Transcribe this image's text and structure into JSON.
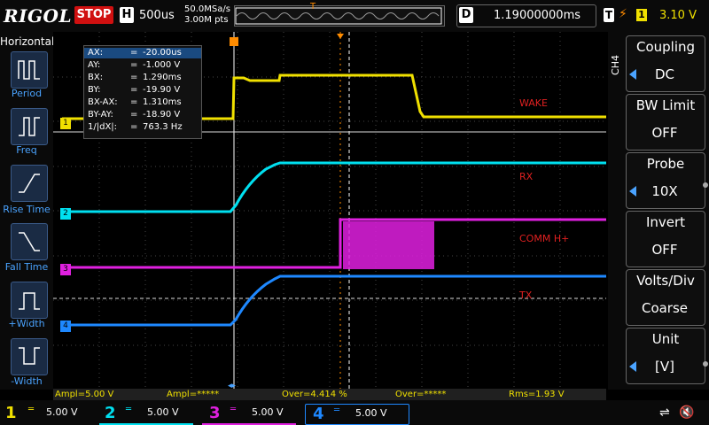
{
  "topbar": {
    "brand": "RIGOL",
    "run_state": "STOP",
    "timebase_label": "H",
    "timebase_value": "500us",
    "sample_rate": "50.0MSa/s",
    "memory_depth": "3.00M pts",
    "delay_label": "D",
    "delay_value": "1.19000000ms",
    "trigger_label": "T",
    "trigger_source": "1",
    "trigger_level": "3.10 V"
  },
  "left_panel": {
    "title": "Horizontal",
    "items": [
      {
        "label": "Period"
      },
      {
        "label": "Freq"
      },
      {
        "label": "Rise Time"
      },
      {
        "label": "Fall Time"
      },
      {
        "label": "+Width"
      },
      {
        "label": "-Width"
      }
    ]
  },
  "cursor_table": [
    {
      "key": "AX:",
      "value": "-20.00us"
    },
    {
      "key": "AY:",
      "value": "-1.000 V"
    },
    {
      "key": "BX:",
      "value": "1.290ms"
    },
    {
      "key": "BY:",
      "value": "-19.90 V"
    },
    {
      "key": "BX-AX:",
      "value": "1.310ms"
    },
    {
      "key": "BY-AY:",
      "value": "-18.90 V"
    },
    {
      "key": "1/|dX|:",
      "value": "763.3 Hz"
    }
  ],
  "trace_labels": {
    "wake": "WAKE",
    "rx": "RX",
    "comm": "COMM H+",
    "tx": "TX"
  },
  "channel_markers": [
    "1",
    "2",
    "3",
    "4"
  ],
  "right_panel": {
    "channel_tag": "CH4",
    "menus": [
      {
        "title": "Coupling",
        "value": "DC"
      },
      {
        "title": "BW Limit",
        "value": "OFF"
      },
      {
        "title": "Probe",
        "value": "10X"
      },
      {
        "title": "Invert",
        "value": "OFF"
      },
      {
        "title": "Volts/Div",
        "value": "Coarse"
      },
      {
        "title": "Unit",
        "value": "[V]"
      }
    ]
  },
  "measurements": [
    {
      "text": "Ampl=5.00 V"
    },
    {
      "text": "Ampl=*****"
    },
    {
      "text": "Over=4.414 %"
    },
    {
      "text": "Over=*****"
    },
    {
      "text": "Rms=1.93 V"
    }
  ],
  "channels": [
    {
      "num": "1",
      "scale": "5.00 V",
      "color": "#f0e000"
    },
    {
      "num": "2",
      "scale": "5.00 V",
      "color": "#00e0f0"
    },
    {
      "num": "3",
      "scale": "5.00 V",
      "color": "#e020e0"
    },
    {
      "num": "4",
      "scale": "5.00 V",
      "color": "#1e88ff"
    }
  ],
  "colors": {
    "ch1": "#f0e000",
    "ch2": "#00e0f0",
    "ch3": "#e020e0",
    "ch4": "#1e88ff",
    "trigger": "#ff8c00",
    "stop": "#d01010"
  }
}
